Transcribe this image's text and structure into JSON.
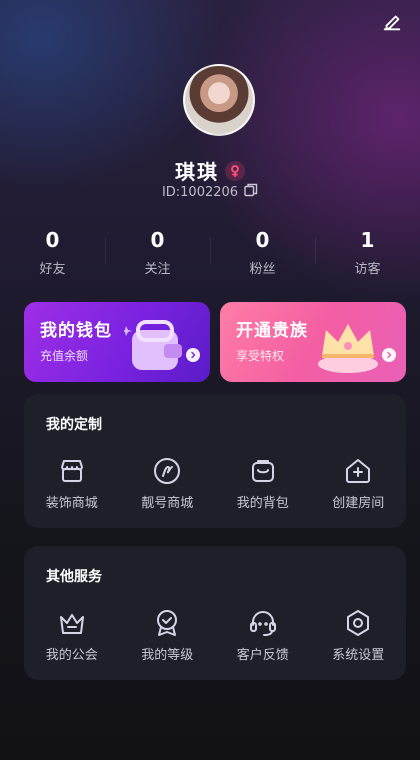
{
  "profile": {
    "name": "琪琪",
    "id_text": "ID:1002206"
  },
  "stats": [
    {
      "value": "0",
      "label": "好友"
    },
    {
      "value": "0",
      "label": "关注"
    },
    {
      "value": "0",
      "label": "粉丝"
    },
    {
      "value": "1",
      "label": "访客"
    }
  ],
  "cards": {
    "wallet": {
      "title": "我的钱包",
      "subtitle": "充值余额"
    },
    "noble": {
      "title": "开通贵族",
      "subtitle": "享受特权"
    }
  },
  "custom": {
    "title": "我的定制",
    "items": [
      {
        "label": "装饰商城",
        "icon": "shop-icon"
      },
      {
        "label": "靓号商城",
        "icon": "pretty-number-icon"
      },
      {
        "label": "我的背包",
        "icon": "backpack-icon"
      },
      {
        "label": "创建房间",
        "icon": "create-room-icon"
      }
    ]
  },
  "services": {
    "title": "其他服务",
    "items": [
      {
        "label": "我的公会",
        "icon": "guild-crown-icon"
      },
      {
        "label": "我的等级",
        "icon": "level-medal-icon"
      },
      {
        "label": "客户反馈",
        "icon": "headset-icon"
      },
      {
        "label": "系统设置",
        "icon": "settings-icon"
      }
    ]
  },
  "colors": {
    "wallet_gradient": "#8a2be2",
    "noble_gradient": "#f45fa3",
    "gender_female": "#ff4f7b",
    "icon_stroke": "#d7d4e8"
  }
}
